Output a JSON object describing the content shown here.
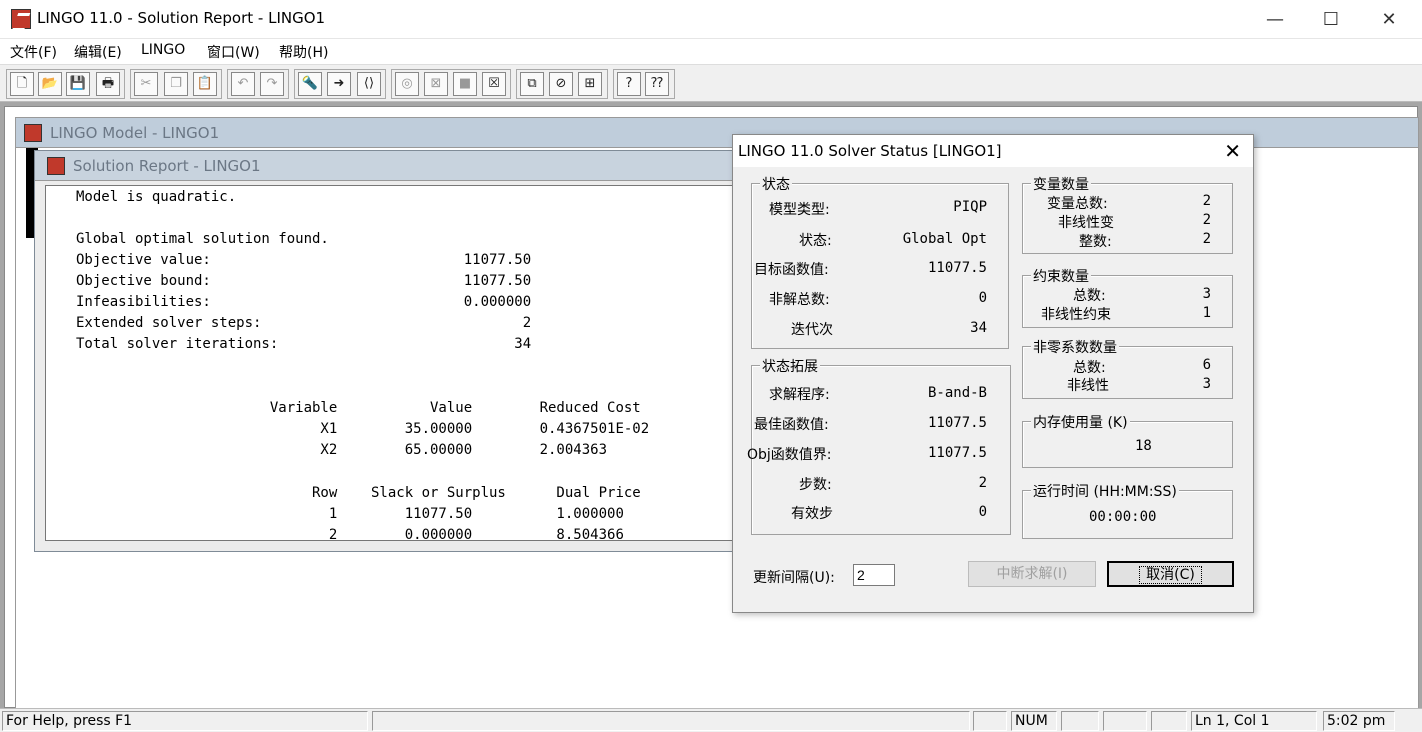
{
  "window": {
    "title": "LINGO 11.0 - Solution Report - LINGO1",
    "min": "—",
    "max": "☐",
    "close": "✕"
  },
  "menu": [
    "文件(F)",
    "编辑(E)",
    "LINGO",
    "窗口(W)",
    "帮助(H)"
  ],
  "toolbar": {
    "icons": [
      "new-icon",
      "open-icon",
      "save-icon",
      "print-icon",
      "cut-icon",
      "copy-icon",
      "paste-icon",
      "undo-icon",
      "redo-icon",
      "find-icon",
      "goto-icon",
      "match-icon",
      "solve-icon",
      "solution-icon",
      "stop-icon",
      "close-all-icon",
      "send-back-icon",
      "tile-icon",
      "cascade-icon",
      "help-icon",
      "context-help-icon"
    ],
    "glyphs": [
      "🗋",
      "📂",
      "💾",
      "🖶",
      "✂",
      "❐",
      "📋",
      "↶",
      "↷",
      "🔦",
      "➜",
      "⟨⟩",
      "◎",
      "⊠",
      "■",
      "☒",
      "⧉",
      "⊘",
      "⊞",
      "?",
      "⁇"
    ]
  },
  "model_window": {
    "title": "LINGO Model - LINGO1"
  },
  "report_window": {
    "title": "Solution Report - LINGO1",
    "lines": [
      "Model is quadratic.",
      "",
      "Global optimal solution found.",
      "Objective value:                              11077.50",
      "Objective bound:                              11077.50",
      "Infeasibilities:                              0.000000",
      "Extended solver steps:                               2",
      "Total solver iterations:                            34",
      "",
      "",
      "                       Variable           Value        Reduced Cost",
      "                             X1        35.00000        0.4367501E-02",
      "                             X2        65.00000        2.004363",
      "",
      "                            Row    Slack or Surplus      Dual Price",
      "                              1        11077.50          1.000000",
      "                              2        0.000000          8.504366"
    ]
  },
  "solver": {
    "title": "LINGO 11.0 Solver Status [LINGO1]",
    "close": "✕",
    "status": {
      "legend": "状态",
      "rows": [
        {
          "label": "模型类型:",
          "value": "PIQP"
        },
        {
          "label": "状态:",
          "value": "Global Opt"
        },
        {
          "label": "目标函数值:",
          "value": "11077.5"
        },
        {
          "label": "非解总数:",
          "value": "0"
        },
        {
          "label": "迭代次",
          "value": "34"
        }
      ]
    },
    "extended": {
      "legend": "状态拓展",
      "rows": [
        {
          "label": "求解程序:",
          "value": "B-and-B"
        },
        {
          "label": "最佳函数值:",
          "value": "11077.5"
        },
        {
          "label": "Obj函数值界:",
          "value": "11077.5"
        },
        {
          "label": "步数:",
          "value": "2"
        },
        {
          "label": "有效步",
          "value": "0"
        }
      ]
    },
    "variables": {
      "legend": "变量数量",
      "rows": [
        {
          "label": "变量总数:",
          "value": "2"
        },
        {
          "label": "非线性变",
          "value": "2"
        },
        {
          "label": "整数:",
          "value": "2"
        }
      ]
    },
    "constraints": {
      "legend": "约束数量",
      "rows": [
        {
          "label": "总数:",
          "value": "3"
        },
        {
          "label": "非线性约束",
          "value": "1"
        }
      ]
    },
    "nonzeros": {
      "legend": "非零系数数量",
      "rows": [
        {
          "label": "总数:",
          "value": "6"
        },
        {
          "label": "非线性",
          "value": "3"
        }
      ]
    },
    "memory": {
      "legend": "内存使用量 (K)",
      "value": "18"
    },
    "runtime": {
      "legend": "运行时间 (HH:MM:SS)",
      "value": "00:00:00"
    },
    "update_label": "更新间隔(U):",
    "update_value": "2",
    "interrupt_button": "中断求解(I)",
    "cancel_button": "取消(C)"
  },
  "statusbar": {
    "help": "For Help, press F1",
    "num": "NUM",
    "position": "Ln 1, Col 1",
    "time": "5:02 pm"
  }
}
